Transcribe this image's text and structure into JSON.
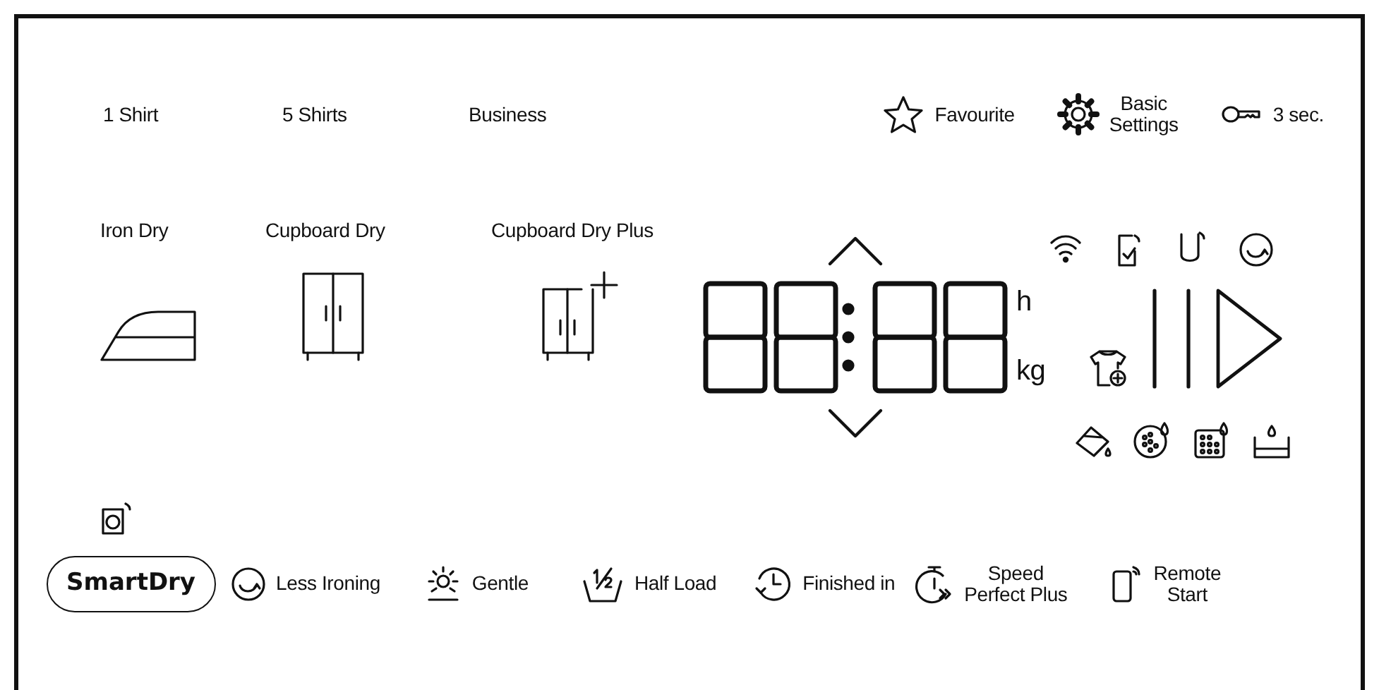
{
  "top_options": [
    {
      "label": "1 Shirt"
    },
    {
      "label": "5 Shirts"
    },
    {
      "label": "Business"
    }
  ],
  "top_functions": [
    {
      "kind": "star",
      "label": "Favourite"
    },
    {
      "kind": "gear",
      "label": "Basic\nSettings"
    },
    {
      "kind": "key",
      "label": "3 sec."
    }
  ],
  "programs": [
    {
      "kind": "iron",
      "label": "Iron Dry"
    },
    {
      "kind": "cupboard",
      "label": "Cupboard Dry"
    },
    {
      "kind": "cupboard_plus",
      "label": "Cupboard Dry Plus"
    }
  ],
  "display": {
    "units": [
      "h",
      "kg"
    ]
  },
  "bottom_buttons": [
    {
      "kind": "pill",
      "label": "SmartDry"
    },
    {
      "kind": "refresh",
      "label": "Less Ironing"
    },
    {
      "kind": "sun",
      "label": "Gentle"
    },
    {
      "kind": "half",
      "label": "Half Load"
    },
    {
      "kind": "clock",
      "label": "Finished in"
    },
    {
      "kind": "timer",
      "label": "Speed\nPerfect Plus"
    },
    {
      "kind": "remote",
      "label": "Remote\nStart"
    }
  ]
}
